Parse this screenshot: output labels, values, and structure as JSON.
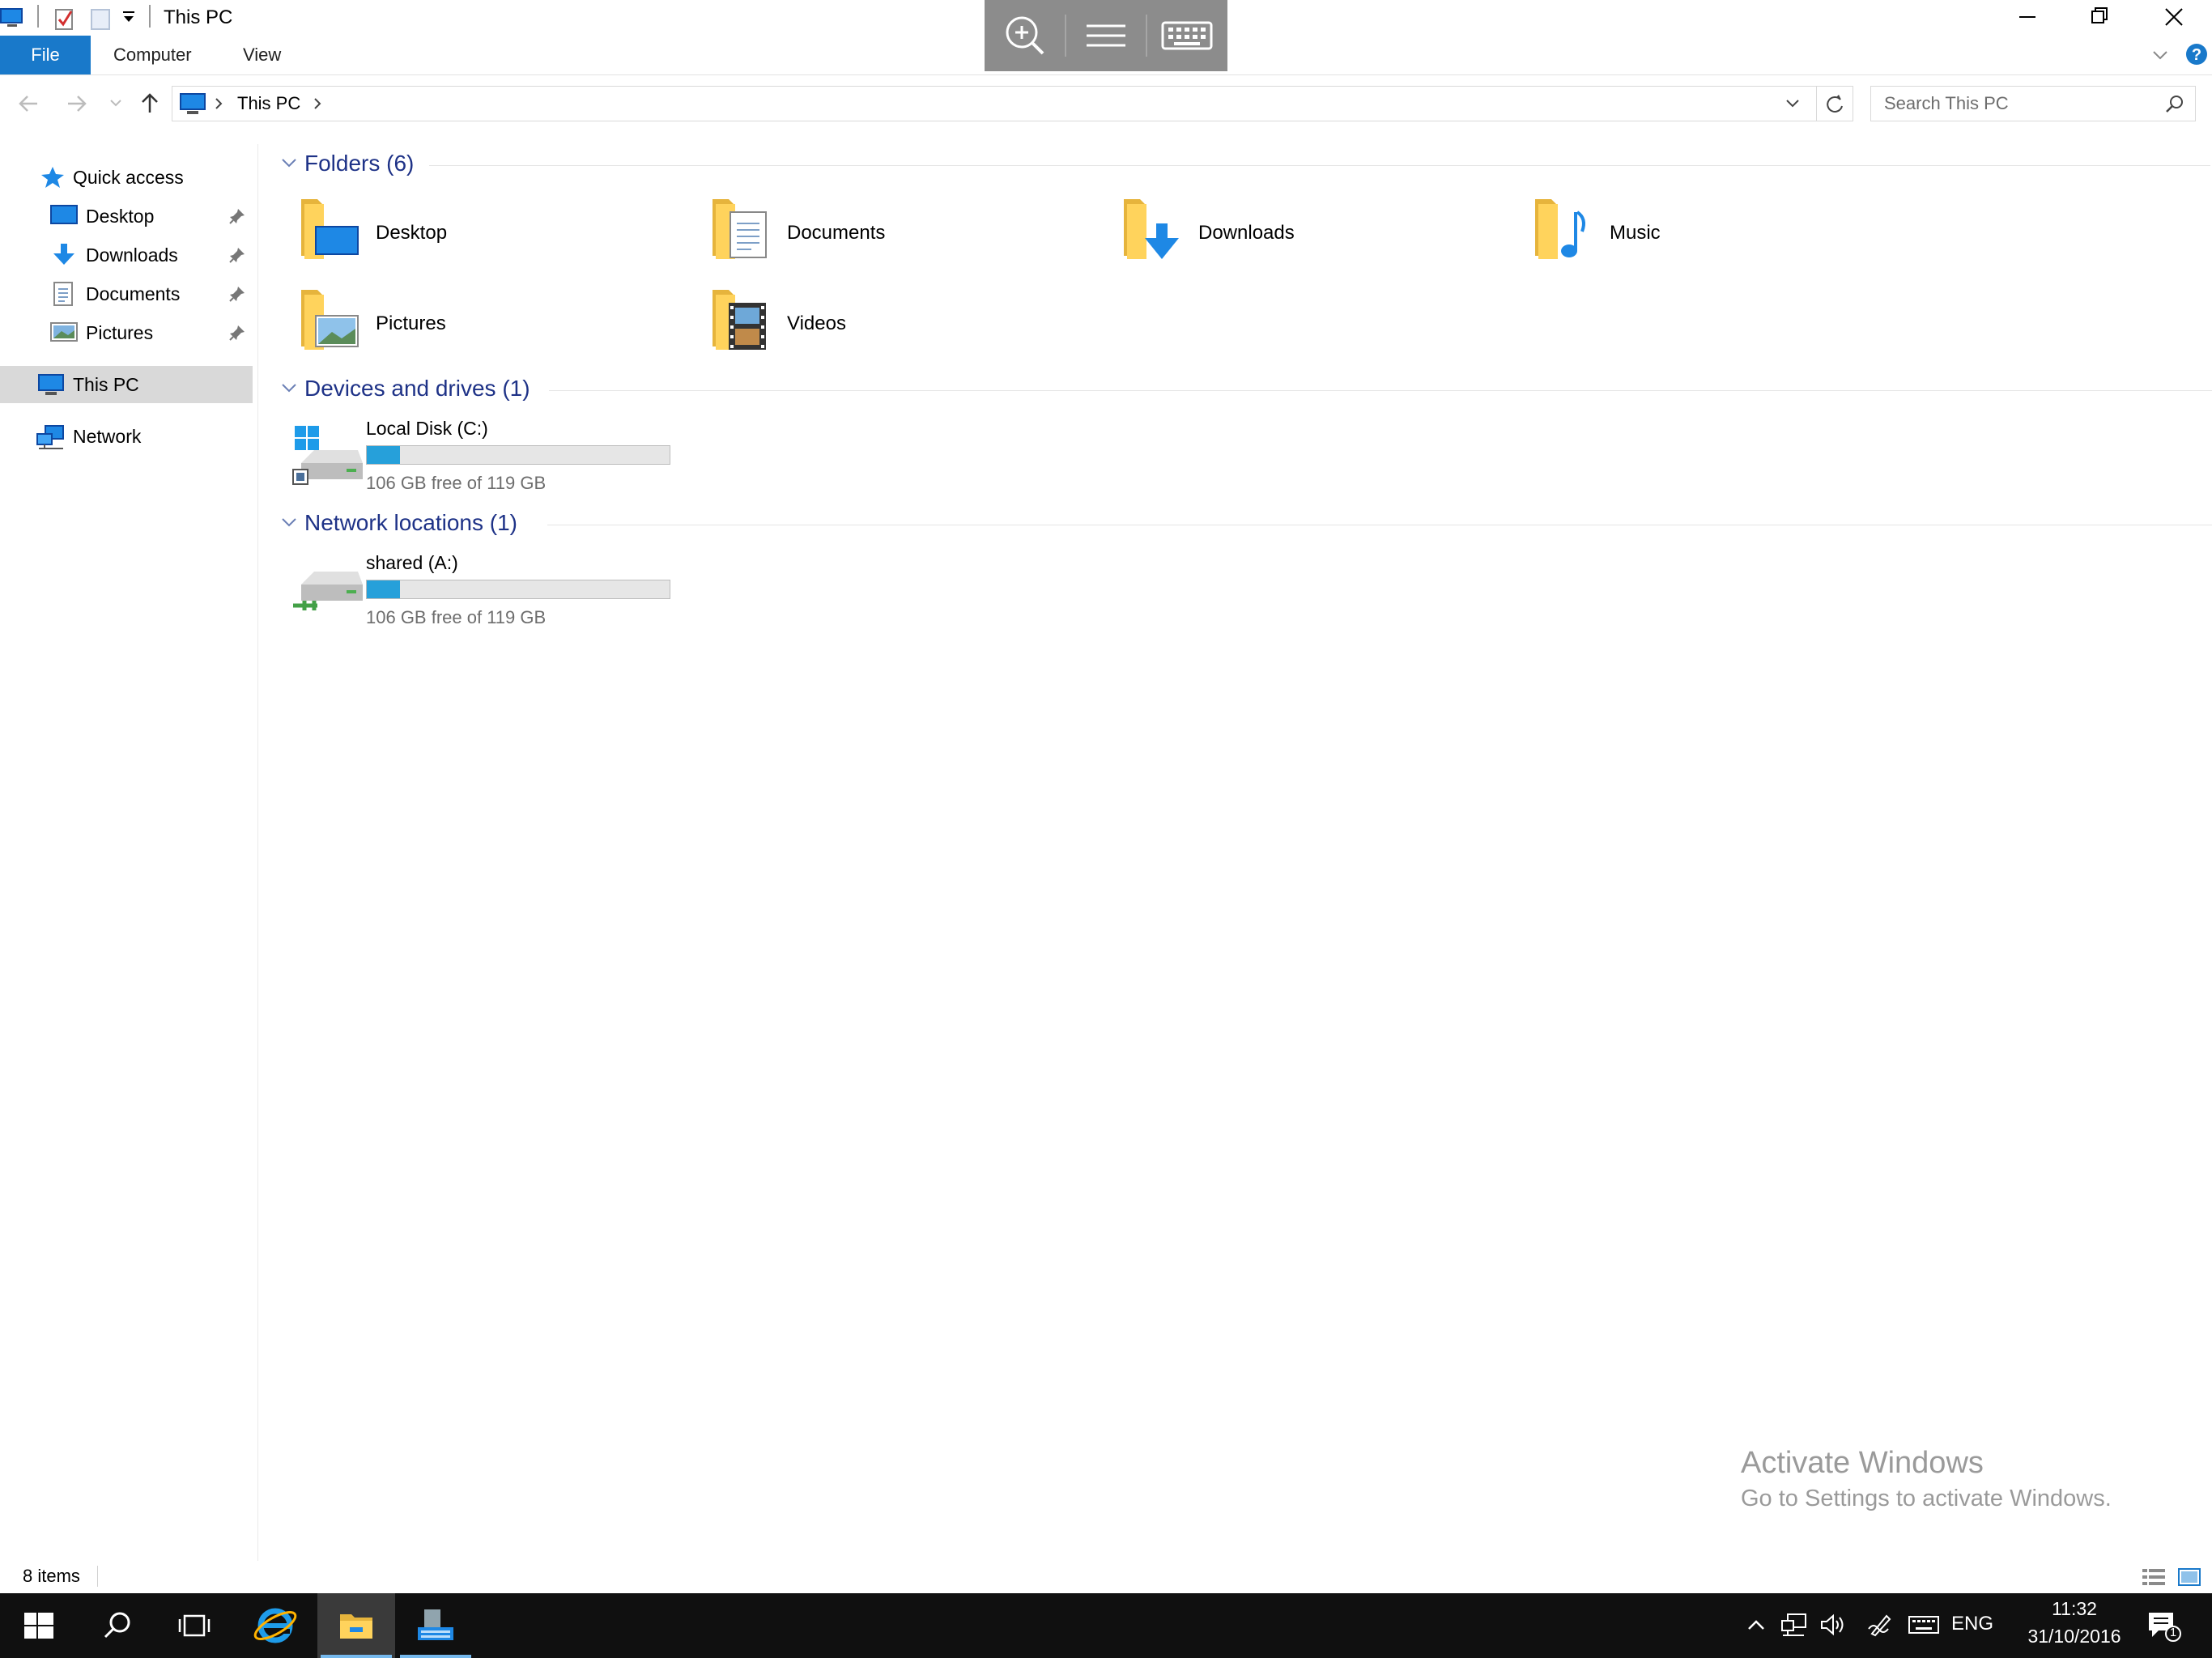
{
  "window": {
    "title": "This PC",
    "controls": [
      "minimize",
      "restore",
      "close"
    ]
  },
  "ribbon": {
    "tabs": [
      {
        "label": "File",
        "active": true
      },
      {
        "label": "Computer"
      },
      {
        "label": "View"
      }
    ]
  },
  "address": {
    "breadcrumb": "This PC",
    "search_placeholder": "Search This PC"
  },
  "nav": {
    "quick_access": "Quick access",
    "pinned": [
      {
        "label": "Desktop",
        "icon": "desktop-icon"
      },
      {
        "label": "Downloads",
        "icon": "download-arrow-icon"
      },
      {
        "label": "Documents",
        "icon": "document-icon"
      },
      {
        "label": "Pictures",
        "icon": "picture-icon"
      }
    ],
    "this_pc": "This PC",
    "network": "Network"
  },
  "groups": {
    "folders": {
      "title": "Folders (6)",
      "items": [
        {
          "label": "Desktop",
          "icon": "desktop-folder-icon"
        },
        {
          "label": "Documents",
          "icon": "documents-folder-icon"
        },
        {
          "label": "Downloads",
          "icon": "downloads-folder-icon"
        },
        {
          "label": "Music",
          "icon": "music-folder-icon"
        },
        {
          "label": "Pictures",
          "icon": "pictures-folder-icon"
        },
        {
          "label": "Videos",
          "icon": "videos-folder-icon"
        }
      ]
    },
    "devices": {
      "title": "Devices and drives (1)",
      "items": [
        {
          "label": "Local Disk (C:)",
          "free": "106 GB free of 119 GB",
          "used_fraction": 0.11,
          "icon": "windows-drive-icon"
        }
      ]
    },
    "network": {
      "title": "Network locations (1)",
      "items": [
        {
          "label": "shared (A:)",
          "free": "106 GB free of 119 GB",
          "used_fraction": 0.11,
          "icon": "network-drive-icon"
        }
      ]
    }
  },
  "watermark": {
    "title": "Activate Windows",
    "subtitle": "Go to Settings to activate Windows."
  },
  "status": {
    "items": "8 items"
  },
  "taskbar": {
    "lang": "ENG",
    "time": "11:32",
    "date": "31/10/2016",
    "notification_count": "1"
  },
  "colors": {
    "accent": "#1979ca",
    "group_header": "#1e3287",
    "drive_fill": "#26a0da",
    "taskbar": "#101010"
  }
}
